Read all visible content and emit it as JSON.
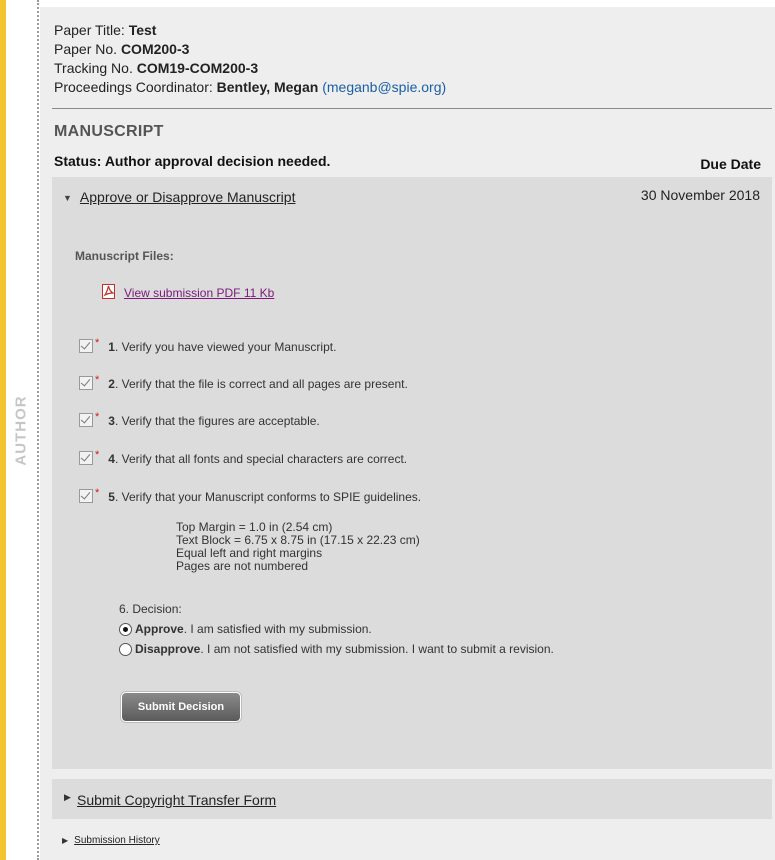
{
  "sidebar": {
    "label": "AUTHOR"
  },
  "paper": {
    "title_label": "Paper Title:",
    "title_value": "Test",
    "no_label": "Paper No.",
    "no_value": "COM200-3",
    "tracking_label": "Tracking No.",
    "tracking_value": "COM19-COM200-3",
    "coordinator_label": "Proceedings Coordinator:",
    "coordinator_name": "Bentley, Megan",
    "coordinator_email": "meganb@spie.org"
  },
  "manuscript": {
    "section_title": "MANUSCRIPT",
    "status": "Status: Author approval decision needed.",
    "due_date_label": "Due Date",
    "approve_link": "Approve or Disapprove Manuscript",
    "due_date": "30 November 2018",
    "files_label": "Manuscript Files:",
    "pdf_link": "View submission PDF 11 Kb",
    "checks": [
      {
        "num": "1",
        "text": ". Verify you have viewed your Manuscript.",
        "checked": true
      },
      {
        "num": "2",
        "text": ". Verify that the file is correct and all pages are present.",
        "checked": true
      },
      {
        "num": "3",
        "text": ". Verify that the figures are acceptable.",
        "checked": true
      },
      {
        "num": "4",
        "text": ". Verify that all fonts and special characters are correct.",
        "checked": true
      },
      {
        "num": "5",
        "text": ". Verify that your Manuscript conforms to SPIE guidelines.",
        "checked": true
      }
    ],
    "guidelines": [
      "Top Margin = 1.0 in (2.54 cm)",
      "Text Block = 6.75 x 8.75 in (17.15 x 22.23 cm)",
      "Equal left and right margins",
      "Pages are not numbered"
    ],
    "decision_label": "6. Decision:",
    "approve_option_bold": "Approve",
    "approve_option_text": ". I am satisfied with my submission.",
    "disapprove_option_bold": "Disapprove",
    "disapprove_option_text": ". I am not satisfied with my submission. I want to submit a revision.",
    "selected_option": "approve",
    "submit_label": "Submit Decision"
  },
  "copyright": {
    "link": "Submit Copyright Transfer Form"
  },
  "history": {
    "link": "Submission History"
  },
  "colors": {
    "accent_bar": "#f4c430",
    "required_star": "#d21b1b",
    "visited_link": "#7a1a7a",
    "email_link": "#1a5fa8"
  }
}
